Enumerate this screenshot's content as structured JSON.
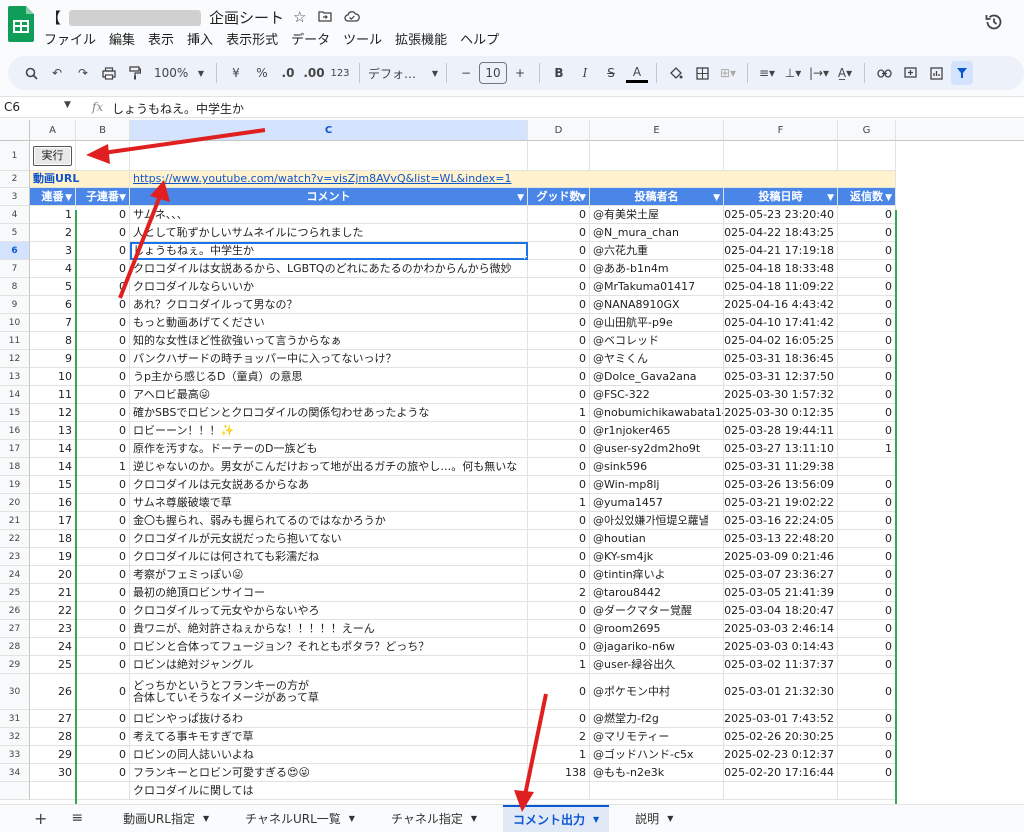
{
  "app": {
    "title_prefix": "【",
    "title_suffix": "企画シート",
    "namebox": "C6",
    "formula": "しょうもねえ。中学生か"
  },
  "menu": [
    "ファイル",
    "編集",
    "表示",
    "挿入",
    "表示形式",
    "データ",
    "ツール",
    "拡張機能",
    "ヘルプ"
  ],
  "toolbar": {
    "zoom": "100%",
    "currency": "¥",
    "percent": "%",
    "dec_minus": ".0",
    "dec_plus": ".00",
    "format_123": "123",
    "font": "デフォ…",
    "font_size": "10"
  },
  "columns": [
    "A",
    "B",
    "C",
    "D",
    "E",
    "F",
    "G"
  ],
  "sheet": {
    "button_label": "実行",
    "url_label": "動画URL",
    "url": "https://www.youtube.com/watch?v=visZjm8AVvQ&list=WL&index=1",
    "headers": [
      "連番",
      "子連番",
      "コメント",
      "グッド数",
      "投稿者名",
      "投稿日時",
      "返信数"
    ],
    "rows": [
      {
        "r": "4",
        "a": "1",
        "b": "0",
        "c": "サムネ、、、",
        "d": "0",
        "e": "@有美栄土屋",
        "f": "2025-05-23 23:20:40",
        "g": "0"
      },
      {
        "r": "5",
        "a": "2",
        "b": "0",
        "c": "人として恥ずかしいサムネイルにつられました",
        "d": "0",
        "e": "@N_mura_chan",
        "f": "2025-04-22 18:43:25",
        "g": "0"
      },
      {
        "r": "6",
        "a": "3",
        "b": "0",
        "c": "しょうもねぇ。中学生か",
        "d": "0",
        "e": "@六花九重",
        "f": "2025-04-21 17:19:18",
        "g": "0"
      },
      {
        "r": "7",
        "a": "4",
        "b": "0",
        "c": "クロコダイルは女説あるから、LGBTQのどれにあたるのかわからんから微妙",
        "d": "0",
        "e": "@ああ-b1n4m",
        "f": "2025-04-18 18:33:48",
        "g": "0"
      },
      {
        "r": "8",
        "a": "5",
        "b": "0",
        "c": "クロコダイルならいいか",
        "d": "0",
        "e": "@MrTakuma01417",
        "f": "2025-04-18 11:09:22",
        "g": "0"
      },
      {
        "r": "9",
        "a": "6",
        "b": "0",
        "c": "あれ？クロコダイルって男なの？",
        "d": "0",
        "e": "@NANA8910GX",
        "f": "2025-04-16 4:43:42",
        "g": "0"
      },
      {
        "r": "10",
        "a": "7",
        "b": "0",
        "c": "もっと動画あげてください",
        "d": "0",
        "e": "@山田航平-p9e",
        "f": "2025-04-10 17:41:42",
        "g": "0"
      },
      {
        "r": "11",
        "a": "8",
        "b": "0",
        "c": "知的な女性ほど性欲強いって言うからなぁ",
        "d": "0",
        "e": "@ベコレッド",
        "f": "2025-04-02 16:05:25",
        "g": "0"
      },
      {
        "r": "12",
        "a": "9",
        "b": "0",
        "c": "パンクハザードの時チョッパー中に入ってないっけ？",
        "d": "0",
        "e": "@ヤミくん",
        "f": "2025-03-31 18:36:45",
        "g": "0"
      },
      {
        "r": "13",
        "a": "10",
        "b": "0",
        "c": "うp主から感じるD（童貞）の意思",
        "d": "0",
        "e": "@Dolce_Gava2ana",
        "f": "2025-03-31 12:37:50",
        "g": "0"
      },
      {
        "r": "14",
        "a": "11",
        "b": "0",
        "c": "アヘロビ最高😜",
        "d": "0",
        "e": "@FSC-322",
        "f": "2025-03-30 1:57:32",
        "g": "0"
      },
      {
        "r": "15",
        "a": "12",
        "b": "0",
        "c": "確かSBSでロビンとクロコダイルの関係匂わせあったような",
        "d": "1",
        "e": "@nobumichikawabata146",
        "f": "2025-03-30 0:12:35",
        "g": "0"
      },
      {
        "r": "16",
        "a": "13",
        "b": "0",
        "c": "ロビーーン！！！✨",
        "d": "0",
        "e": "@r1njoker465",
        "f": "2025-03-28 19:44:11",
        "g": "0"
      },
      {
        "r": "17",
        "a": "14",
        "b": "0",
        "c": "原作を汚すな。ドーテーのD一族ども",
        "d": "0",
        "e": "@user-sy2dm2ho9t",
        "f": "2025-03-27 13:11:10",
        "g": "1"
      },
      {
        "r": "18",
        "a": "14",
        "b": "1",
        "c": "逆じゃないのか。男女がこんだけおって地が出るガチの旅やし…。何も無いな",
        "d": "0",
        "e": "@sink596",
        "f": "2025-03-31 11:29:38",
        "g": ""
      },
      {
        "r": "19",
        "a": "15",
        "b": "0",
        "c": "クロコダイルは元女説あるからなあ",
        "d": "0",
        "e": "@Win-mp8lj",
        "f": "2025-03-26 13:56:09",
        "g": "0"
      },
      {
        "r": "20",
        "a": "16",
        "b": "0",
        "c": "サムネ尊厳破壊で草",
        "d": "1",
        "e": "@yuma1457",
        "f": "2025-03-21 19:02:22",
        "g": "0"
      },
      {
        "r": "21",
        "a": "17",
        "b": "0",
        "c": "金〇も握られ、弱みも握られてるのではなかろうか",
        "d": "0",
        "e": "@아싰었嫌가恒堤오蘿냴",
        "f": "2025-03-16 22:24:05",
        "g": "0"
      },
      {
        "r": "22",
        "a": "18",
        "b": "0",
        "c": "クロコダイルが元女説だったら抱いてない",
        "d": "0",
        "e": "@houtian",
        "f": "2025-03-13 22:48:20",
        "g": "0"
      },
      {
        "r": "23",
        "a": "19",
        "b": "0",
        "c": "クロコダイルには何されても彩濡だね",
        "d": "0",
        "e": "@KY-sm4jk",
        "f": "2025-03-09 0:21:46",
        "g": "0"
      },
      {
        "r": "24",
        "a": "20",
        "b": "0",
        "c": "考察がフェミっぽい😜",
        "d": "0",
        "e": "@tintin痒いよ",
        "f": "2025-03-07 23:36:27",
        "g": "0"
      },
      {
        "r": "25",
        "a": "21",
        "b": "0",
        "c": "最初の絶頂ロビンサイコー",
        "d": "2",
        "e": "@tarou8442",
        "f": "2025-03-05 21:41:39",
        "g": "0"
      },
      {
        "r": "26",
        "a": "22",
        "b": "0",
        "c": "クロコダイルって元女やからないやろ",
        "d": "0",
        "e": "@ダークマター覚醒",
        "f": "2025-03-04 18:20:47",
        "g": "0"
      },
      {
        "r": "27",
        "a": "23",
        "b": "0",
        "c": "貴ワニが、絶対許さねぇからな！！！！！えーん",
        "d": "0",
        "e": "@room2695",
        "f": "2025-03-03 2:46:14",
        "g": "0"
      },
      {
        "r": "28",
        "a": "24",
        "b": "0",
        "c": "ロビンと合体ってフュージョン？それともポタラ？どっち？",
        "d": "0",
        "e": "@jagariko-n6w",
        "f": "2025-03-03 0:14:43",
        "g": "0"
      },
      {
        "r": "29",
        "a": "25",
        "b": "0",
        "c": "ロビンは絶対ジャングル",
        "d": "1",
        "e": "@user-緑谷出久",
        "f": "2025-03-02 11:37:37",
        "g": "0"
      },
      {
        "r": "30",
        "a": "26",
        "b": "0",
        "c": "どっちかというとフランキーの方が",
        "c2": "合体していそうなイメージがあって草",
        "d": "0",
        "e": "@ポケモン中村",
        "f": "2025-03-01 21:32:30",
        "g": "0",
        "tall": true
      },
      {
        "r": "31",
        "a": "27",
        "b": "0",
        "c": "ロビンやっぱ抜けるわ",
        "d": "0",
        "e": "@燃堂力-f2g",
        "f": "2025-03-01 7:43:52",
        "g": "0"
      },
      {
        "r": "32",
        "a": "28",
        "b": "0",
        "c": "考えてる事キモすぎで草",
        "d": "2",
        "e": "@マリモティー",
        "f": "2025-02-26 20:30:25",
        "g": "0"
      },
      {
        "r": "33",
        "a": "29",
        "b": "0",
        "c": "ロビンの同人誌いいよね",
        "d": "1",
        "e": "@ゴッドハンド-c5x",
        "f": "2025-02-23 0:12:37",
        "g": "0"
      },
      {
        "r": "34",
        "a": "30",
        "b": "0",
        "c": "フランキーとロビン可愛すぎる😍😜",
        "d": "138",
        "e": "@もも-n2e3k",
        "f": "2025-02-20 17:16:44",
        "g": "0"
      },
      {
        "r": "",
        "a": "",
        "b": "",
        "c": "クロコダイルに関しては",
        "d": "",
        "e": "",
        "f": "",
        "g": ""
      }
    ]
  },
  "tabs": [
    "動画URL指定",
    "チャネルURL一覧",
    "チャネル指定",
    "コメント出力",
    "説明"
  ]
}
